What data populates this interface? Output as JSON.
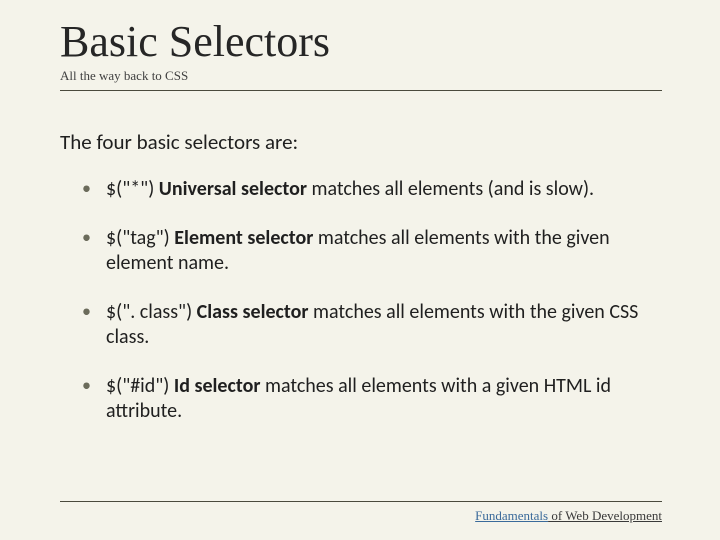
{
  "title": "Basic Selectors",
  "subtitle": "All the way back to CSS",
  "intro": "The four basic selectors are:",
  "bullets": [
    {
      "code": "$(\"*\") ",
      "strong": "Universal selector",
      "rest": " matches all elements (and is slow)."
    },
    {
      "code": "$(\"tag\") ",
      "strong": "Element selector",
      "rest": " matches all elements with the given element name."
    },
    {
      "code": "$(\". class\") ",
      "strong": "Class selector",
      "rest": " matches all elements with the given CSS class."
    },
    {
      "code": "$(\"#id\") ",
      "strong": "Id selector",
      "rest": " matches all elements with a given HTML id attribute."
    }
  ],
  "footer": {
    "accent": "Fundamentals",
    "rest": " of Web Development"
  }
}
